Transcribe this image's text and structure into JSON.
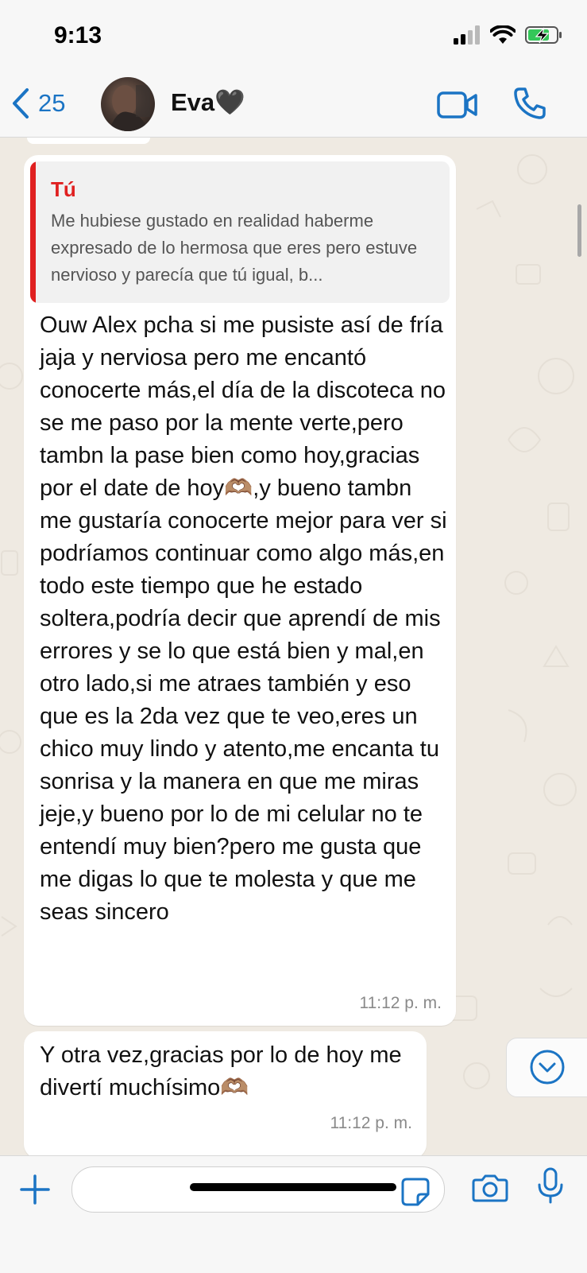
{
  "status_bar": {
    "time": "9:13"
  },
  "header": {
    "back_count": "25",
    "contact_name": "Eva🖤"
  },
  "messages": [
    {
      "quote_author": "Tú",
      "quote_text": "Me hubiese gustado en realidad haberme expresado de lo hermosa que eres pero estuve nervioso y parecía que tú igual, b...",
      "text": "Ouw Alex pcha si me pusiste así de fría jaja y nerviosa pero me encantó conocerte más,el día de la discoteca no se me paso por la mente verte,pero tambn la pase bien como hoy,gracias por el date de hoy🫶🏽,y bueno tambn me gustaría conocerte mejor para ver si podríamos continuar como algo más,en todo este tiempo que he estado soltera,podría decir que aprendí de mis errores y se lo que está bien y mal,en otro lado,si me atraes también y eso que es la 2da vez que te veo,eres un chico muy lindo y atento,me encanta tu sonrisa y la manera en que me miras jeje,y bueno por lo de mi celular no te entendí muy bien?pero me gusta que me digas lo que te molesta y que me seas sincero",
      "time": "11:12 p. m."
    },
    {
      "text": "Y otra vez,gracias por lo de hoy me divertí muchísimo🫶🏽",
      "time": "11:12 p. m."
    }
  ],
  "input": {
    "value": "",
    "placeholder": ""
  },
  "colors": {
    "accent": "#1b74c4",
    "quote_accent": "#e02020",
    "chat_bg": "#efeae2"
  }
}
